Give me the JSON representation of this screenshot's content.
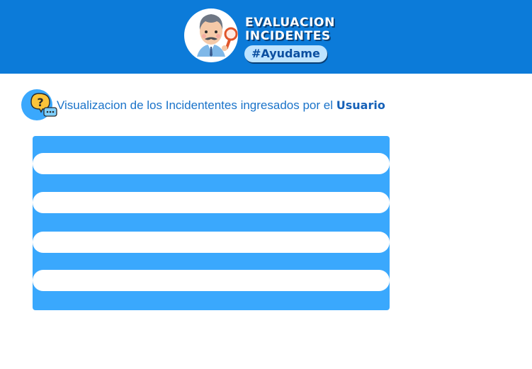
{
  "header": {
    "brand_line1": "EVALUACION",
    "brand_line2": "INCIDENTES",
    "tag": "#Ayudame",
    "logo_icon": "inspector-avatar-icon",
    "background_color": "#0c7bd9"
  },
  "section": {
    "icon": "question-chat-icon",
    "title_prefix": "Visualizacion de los Incidententes ingresados por el",
    "title_emphasis": "Usuario"
  },
  "incidents_panel": {
    "background_color": "#3aa8fd",
    "rows": [
      "",
      "",
      "",
      ""
    ]
  }
}
